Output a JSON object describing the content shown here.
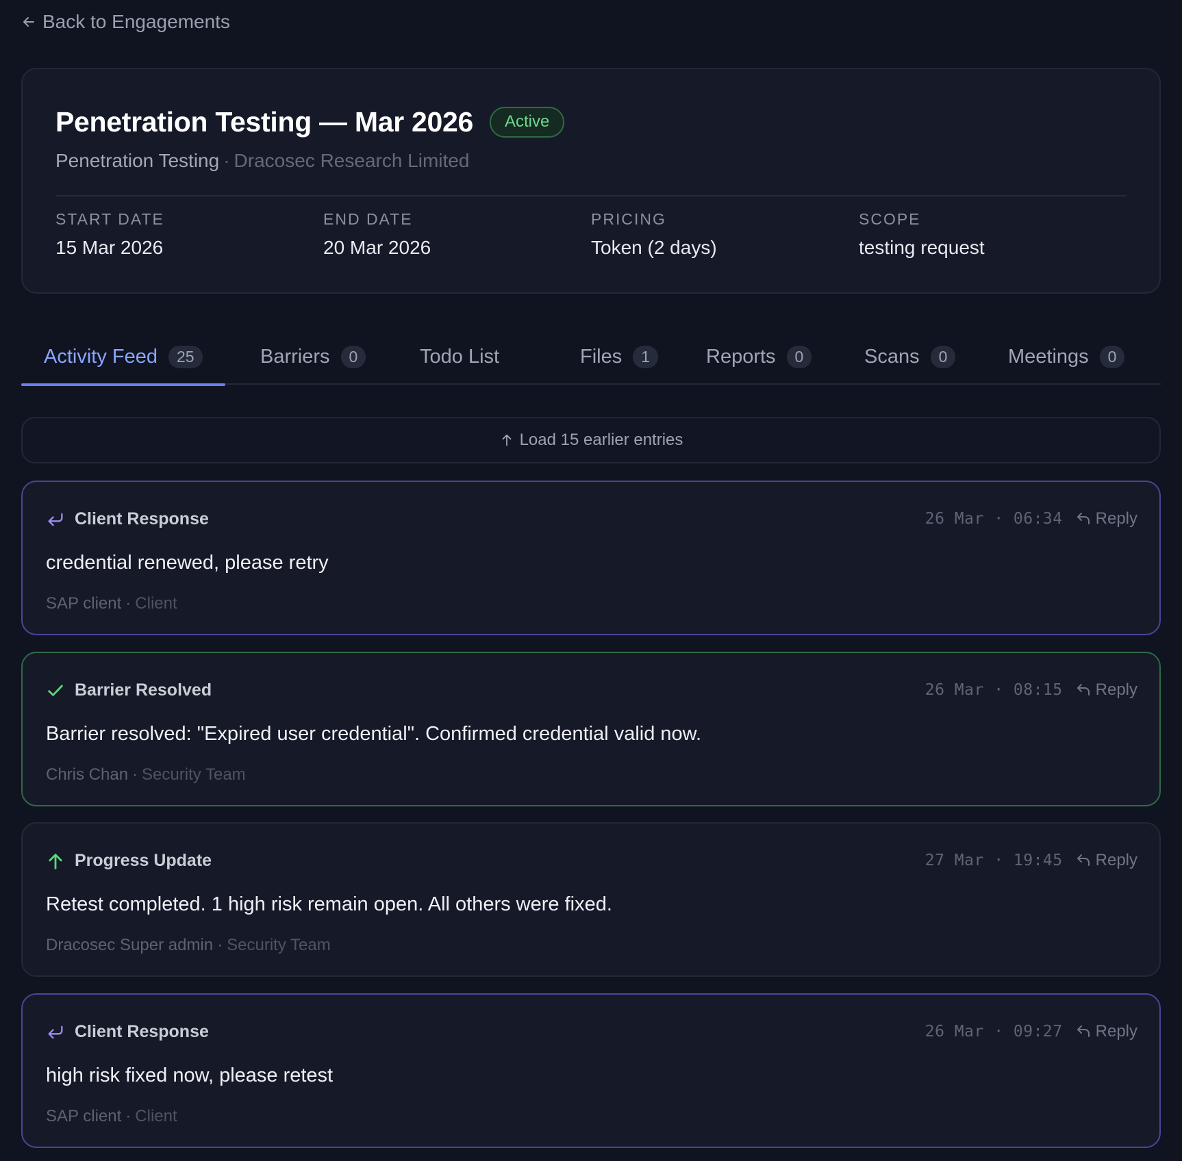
{
  "nav": {
    "back_label": "Back to Engagements"
  },
  "engagement": {
    "title": "Penetration Testing — Mar 2026",
    "status": "Active",
    "service": "Penetration Testing",
    "organization": "Dracosec Research Limited",
    "meta": [
      {
        "label": "START DATE",
        "value": "15 Mar 2026"
      },
      {
        "label": "END DATE",
        "value": "20 Mar 2026"
      },
      {
        "label": "PRICING",
        "value": "Token (2 days)"
      },
      {
        "label": "SCOPE",
        "value": "testing request"
      }
    ]
  },
  "tabs": [
    {
      "label": "Activity Feed",
      "count": "25",
      "active": true
    },
    {
      "label": "Barriers",
      "count": "0"
    },
    {
      "label": "Todo List",
      "count": null
    },
    {
      "label": "Files",
      "count": "1"
    },
    {
      "label": "Reports",
      "count": "0"
    },
    {
      "label": "Scans",
      "count": "0"
    },
    {
      "label": "Meetings",
      "count": "0"
    }
  ],
  "feed": {
    "load_earlier_label": "Load 15 earlier entries",
    "reply_label": "Reply",
    "entries": [
      {
        "type": "Client Response",
        "kind": "client",
        "icon": "reply-arrow-icon",
        "time": "26 Mar · 06:34",
        "body": "credential renewed, please retry",
        "author": "SAP client",
        "role": "Client"
      },
      {
        "type": "Barrier Resolved",
        "kind": "resolved",
        "icon": "check-icon",
        "time": "26 Mar · 08:15",
        "body": "Barrier resolved: \"Expired user credential\". Confirmed credential valid now.",
        "author": "Chris Chan",
        "role": "Security Team"
      },
      {
        "type": "Progress Update",
        "kind": "progress",
        "icon": "arrow-up-icon",
        "time": "27 Mar · 19:45",
        "body": "Retest completed. 1 high risk remain open. All others were fixed.",
        "author": "Dracosec Super admin",
        "role": "Security Team"
      },
      {
        "type": "Client Response",
        "kind": "client",
        "icon": "reply-arrow-icon",
        "time": "26 Mar · 09:27",
        "body": "high risk fixed now, please retest",
        "author": "SAP client",
        "role": "Client"
      }
    ]
  },
  "colors": {
    "background": "#101320",
    "accent": "#8aa6ff",
    "active_badge": "#6fd890",
    "client_border": "#4b4597",
    "resolved_border": "#2f6b45"
  }
}
